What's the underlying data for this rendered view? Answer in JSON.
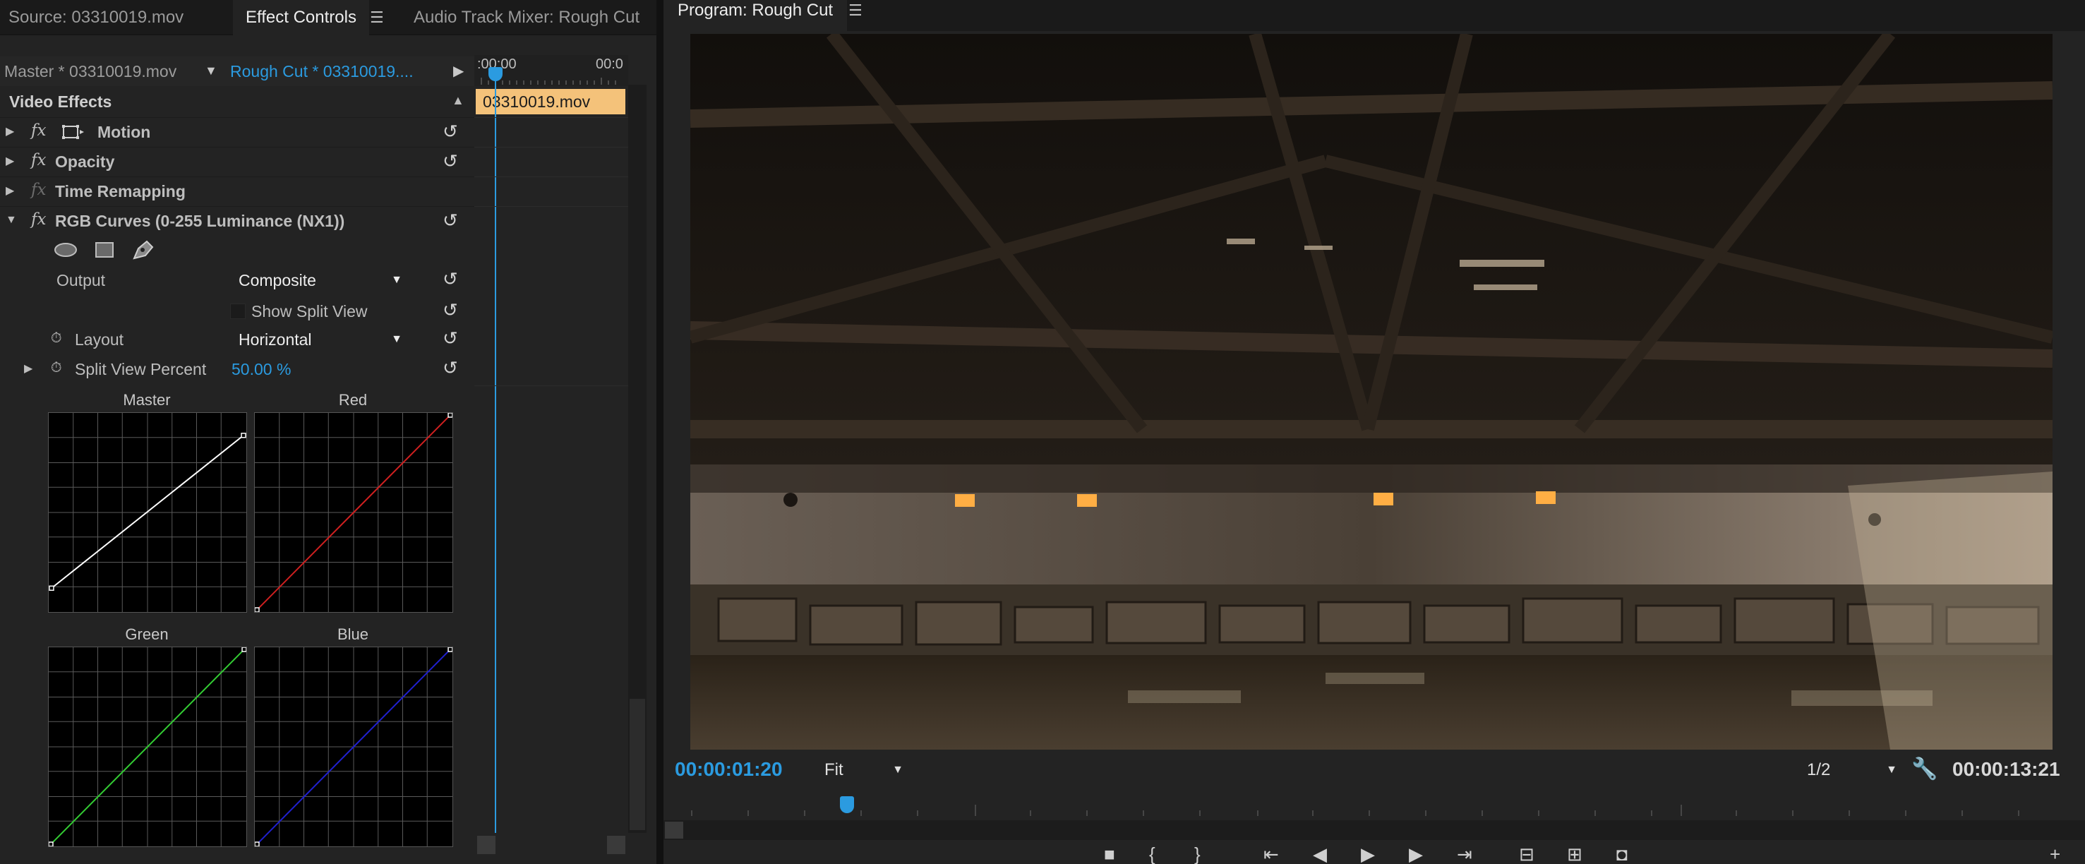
{
  "tabs": {
    "source": "Source: 03310019.mov",
    "effect_controls": "Effect Controls",
    "audio_mixer": "Audio Track Mixer: Rough Cut",
    "program": "Program: Rough Cut"
  },
  "effect_controls": {
    "master_clip": "Master * 03310019.mov",
    "sequence_clip": "Rough Cut * 03310019....",
    "ruler_start": ":00:00",
    "ruler_end": "00:0",
    "clip_name": "03310019.mov",
    "section": "Video Effects",
    "effects": [
      {
        "name": "Motion"
      },
      {
        "name": "Opacity"
      },
      {
        "name": "Time Remapping"
      },
      {
        "name": "RGB Curves (0-255 Luminance (NX1))"
      }
    ],
    "output_label": "Output",
    "output_value": "Composite",
    "split_view_label": "Show Split View",
    "layout_label": "Layout",
    "layout_value": "Horizontal",
    "split_percent_label": "Split View Percent",
    "split_percent_value": "50.00 %",
    "curves": {
      "master": "Master",
      "red": "Red",
      "green": "Green",
      "blue": "Blue"
    }
  },
  "program_monitor": {
    "current_timecode": "00:00:01:20",
    "zoom": "Fit",
    "resolution": "1/2",
    "duration_timecode": "00:00:13:21"
  },
  "colors": {
    "accent": "#2b9be0",
    "clip": "#f4c27a",
    "curve_master": "#ffffff",
    "curve_red": "#d02020",
    "curve_green": "#33cc33",
    "curve_blue": "#2020d0"
  },
  "icons": [
    "disclosure-triangle-icon",
    "fx-badge-icon",
    "motion-transform-icon",
    "reset-icon",
    "ellipse-mask-icon",
    "rectangle-mask-icon",
    "pen-mask-icon",
    "stopwatch-icon",
    "dropdown-arrow-icon",
    "wrench-icon",
    "play-icon",
    "step-back-icon",
    "step-forward-icon",
    "mark-in-icon",
    "mark-out-icon",
    "camera-icon",
    "lift-icon",
    "extract-icon"
  ]
}
